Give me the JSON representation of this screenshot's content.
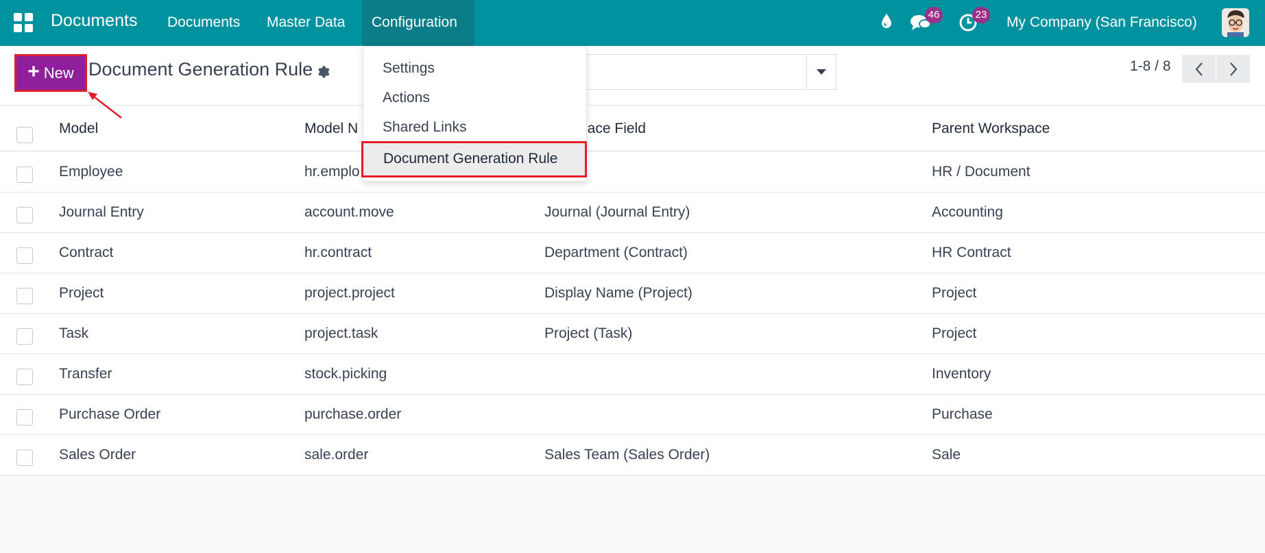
{
  "topbar": {
    "app_name": "Documents",
    "menu": [
      "Documents",
      "Master Data",
      "Configuration"
    ],
    "messages_count": "46",
    "activities_count": "23",
    "company": "My Company (San Francisco)",
    "bg_color": "#00929f"
  },
  "control": {
    "new_label": "New",
    "title": "Document Generation Rule",
    "pager": "1-8 / 8"
  },
  "config_menu": {
    "items": [
      "Settings",
      "Actions",
      "Shared Links",
      "Document Generation Rule"
    ]
  },
  "table": {
    "headers": [
      "Model",
      "Model N",
      "pace Field",
      "Parent Workspace"
    ],
    "rows": [
      {
        "model": "Employee",
        "model_name": "hr.emplo",
        "field": "",
        "workspace": "HR / Document"
      },
      {
        "model": "Journal Entry",
        "model_name": "account.move",
        "field": "Journal (Journal Entry)",
        "workspace": "Accounting"
      },
      {
        "model": "Contract",
        "model_name": "hr.contract",
        "field": "Department (Contract)",
        "workspace": "HR Contract"
      },
      {
        "model": "Project",
        "model_name": "project.project",
        "field": "Display Name (Project)",
        "workspace": "Project"
      },
      {
        "model": "Task",
        "model_name": "project.task",
        "field": "Project (Task)",
        "workspace": "Project"
      },
      {
        "model": "Transfer",
        "model_name": "stock.picking",
        "field": "",
        "workspace": "Inventory"
      },
      {
        "model": "Purchase Order",
        "model_name": "purchase.order",
        "field": "",
        "workspace": "Purchase"
      },
      {
        "model": "Sales Order",
        "model_name": "sale.order",
        "field": "Sales Team (Sales Order)",
        "workspace": "Sale"
      }
    ]
  },
  "annotation_color": "#e11d2a"
}
